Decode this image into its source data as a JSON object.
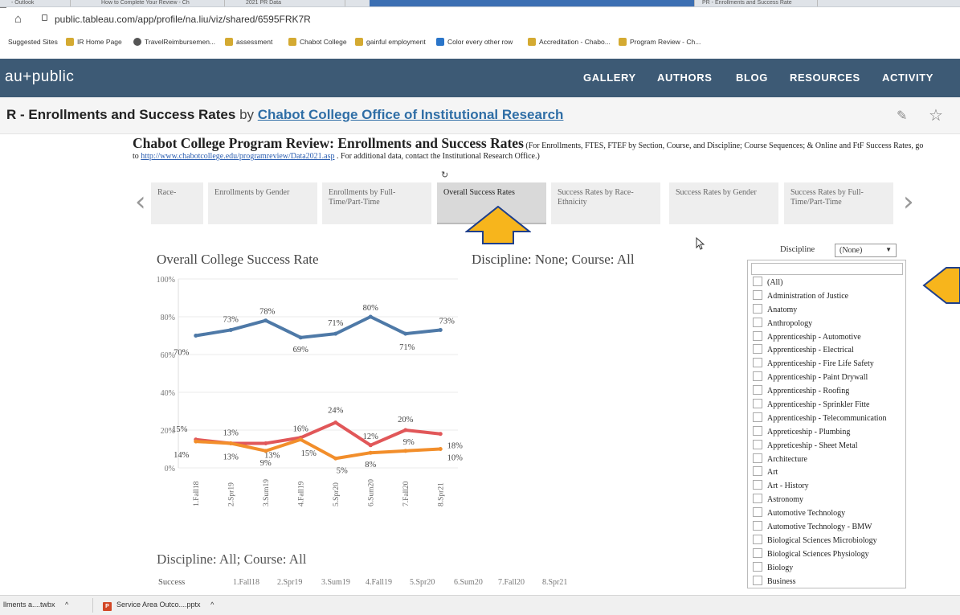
{
  "browser": {
    "tabs": [
      {
        "label": "- Outlook",
        "active": false
      },
      {
        "label": "How to Complete Your Review - Ch",
        "active": false
      },
      {
        "label": "2021 PR Data",
        "active": false
      },
      {
        "label": "",
        "active": true
      },
      {
        "label": "PR - Enrollments and Success Rate",
        "active": false
      }
    ],
    "url": "public.tableau.com/app/profile/na.liu/viz/shared/6595FRK7R",
    "bookmarks": [
      {
        "label": "Suggested Sites",
        "icon": "folder"
      },
      {
        "label": "IR Home Page",
        "icon": "tableau"
      },
      {
        "label": "TravelReimbursemen...",
        "icon": "globe"
      },
      {
        "label": "assessment",
        "icon": "tableau"
      },
      {
        "label": "Chabot College",
        "icon": "tableau"
      },
      {
        "label": "gainful employment",
        "icon": "tableau"
      },
      {
        "label": "Color every other row",
        "icon": "blue"
      },
      {
        "label": "Accreditation - Chabo...",
        "icon": "tableau"
      },
      {
        "label": "Program Review - Ch...",
        "icon": "tableau"
      }
    ]
  },
  "site": {
    "logo": "au+public",
    "nav": [
      "GALLERY",
      "AUTHORS",
      "BLOG",
      "RESOURCES",
      "ACTIVITY"
    ]
  },
  "viz": {
    "title": "R - Enrollments and Success Rates",
    "by": "by",
    "author": "Chabot College Office of Institutional Research"
  },
  "dashboard": {
    "heading": "Chabot College Program Review: Enrollments and Success Rates",
    "subtext1": "(For Enrollments, FTES, FTEF by Section, Course, and Discipline; Course Sequences; & Online and FtF Success Rates, go to",
    "link": "http://www.chabotcollege.edu/programreview/Data2021.asp",
    "subtext2": ". For additional data, contact the Institutional Research Office.)",
    "tabs": [
      {
        "label": "Race-",
        "selected": false
      },
      {
        "label": "Enrollments by Gender",
        "selected": false
      },
      {
        "label": "Enrollments by Full-Time/Part-Time",
        "selected": false
      },
      {
        "label": "Overall Success Rates",
        "selected": true
      },
      {
        "label": "Success Rates by Race-Ethnicity",
        "selected": false
      },
      {
        "label": "Success Rates by Gender",
        "selected": false
      },
      {
        "label": "Success Rates by Full-Time/Part-Time",
        "selected": false
      }
    ],
    "chart_title": "Overall College Success Rate",
    "filter_caption": "Discipline: None; Course: All",
    "bottom_caption": "Discipline: All; Course: All",
    "bottom_row_label": "Success",
    "bottom_row_terms": [
      "1.Fall18",
      "2.Spr19",
      "3.Sum19",
      "4.Fall19",
      "5.Spr20",
      "6.Sum20",
      "7.Fall20",
      "8.Spr21"
    ],
    "discipline_label": "Discipline",
    "discipline_selected": "(None)",
    "discipline_options": [
      "(All)",
      "Administration of Justice",
      "Anatomy",
      "Anthropology",
      "Apprenticeship - Automotive",
      "Apprenticeship - Electrical",
      "Apprenticeship - Fire Life Safety",
      "Apprenticeship - Paint Drywall",
      "Apprenticeship - Roofing",
      "Apprenticeship - Sprinkler Fitte",
      "Apprenticeship - Telecommunication",
      "Appreticeship - Plumbing",
      "Appreticeship - Sheet Metal",
      "Architecture",
      "Art",
      "Art - History",
      "Astronomy",
      "Automotive Technology",
      "Automotive Technology - BMW",
      "Biological Sciences Microbiology",
      "Biological Sciences Physiology",
      "Biology",
      "Business"
    ]
  },
  "chart_data": {
    "type": "line",
    "title": "Overall College Success Rate",
    "x": [
      "1.Fall18",
      "2.Spr19",
      "3.Sum19",
      "4.Fall19",
      "5.Spr20",
      "6.Sum20",
      "7.Fall20",
      "8.Spr21"
    ],
    "ylim": [
      0,
      100
    ],
    "yticks": [
      "0%",
      "20%",
      "40%",
      "60%",
      "80%",
      "100%"
    ],
    "grid": true,
    "series": [
      {
        "color": "#4e79a7",
        "values": [
          70,
          73,
          78,
          69,
          71,
          80,
          71,
          73
        ],
        "labels": [
          "70%",
          "73%",
          "78%",
          "69%",
          "71%",
          "80%",
          "71%",
          "73%"
        ]
      },
      {
        "color": "#e15759",
        "values": [
          15,
          13,
          13,
          16,
          24,
          12,
          20,
          18
        ],
        "labels": [
          "15%",
          "13%",
          "13%",
          "16%",
          "24%",
          "12%",
          "20%",
          "18%"
        ]
      },
      {
        "color": "#f28e2b",
        "values": [
          14,
          13,
          9,
          15,
          5,
          8,
          9,
          10
        ],
        "labels": [
          "14%",
          "13%",
          "9%",
          "15%",
          "5%",
          "8%",
          "9%",
          "10%"
        ]
      }
    ]
  },
  "downloads": [
    {
      "label": "llments a....twbx"
    },
    {
      "label": "Service Area Outco....pptx"
    }
  ]
}
